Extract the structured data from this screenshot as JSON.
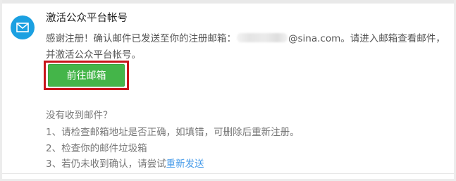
{
  "header": {
    "icon": "mail-icon",
    "icon_color": "#1ba0e1",
    "title": "激活公众平台帐号"
  },
  "message": {
    "line1_prefix": "感谢注册！确认邮件已发送至你的注册邮箱：",
    "email_domain": "@sina.com",
    "line1_suffix": "。请进入邮箱查看邮件，",
    "line2": "并激活公众平台帐号。"
  },
  "actions": {
    "go_mailbox_label": "前往邮箱",
    "button_color": "#44b549",
    "highlight_color": "#c8151b"
  },
  "help": {
    "question": "没有收到邮件？",
    "item1": "1、请检查邮箱地址是否正确，如填错，可删除后重新注册。",
    "item2": "2、检查你的邮件垃圾箱",
    "item3_prefix": "3、若仍未收到确认，请尝试",
    "resend_label": "重新发送",
    "link_color": "#459ae9"
  }
}
